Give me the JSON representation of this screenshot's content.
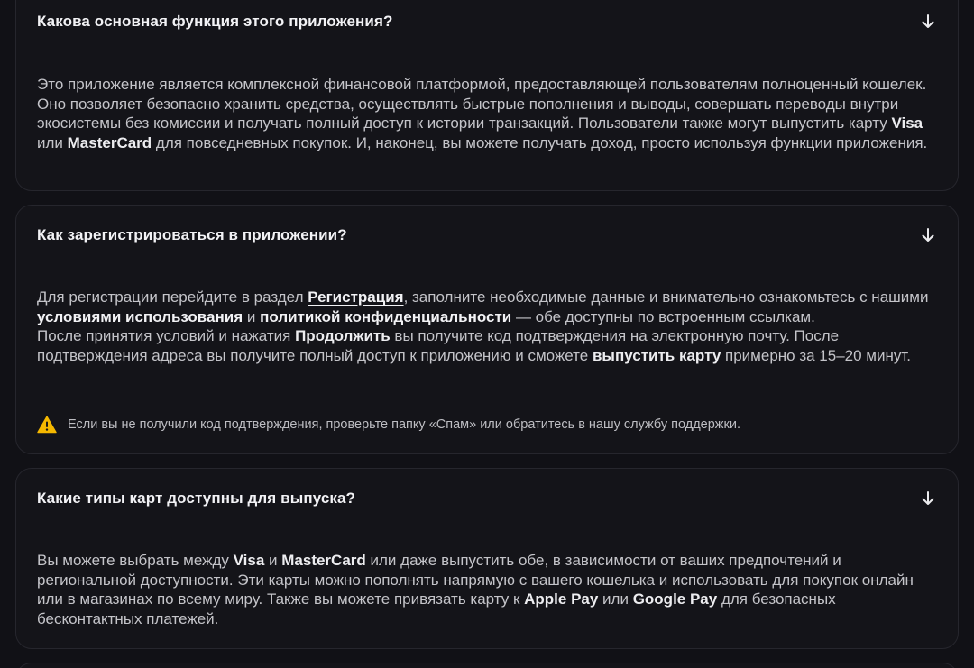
{
  "colors": {
    "background": "#111116",
    "card": "#141419",
    "border": "#26262d",
    "warning": "#f5b800"
  },
  "faq": [
    {
      "question": "Какова основная функция этого приложения?",
      "icon": "arrow-down-icon",
      "answer": {
        "t1": "Это приложение является комплексной финансовой платформой, предоставляющей пользователям полноценный кошелек. Оно позволяет безопасно хранить средства, осуществлять быстрые пополнения и выводы, совершать переводы внутри экосистемы без комиссии и получать полный доступ к истории транзакций. Пользователи также могут выпустить карту ",
        "b1": "Visa",
        "t2": " или ",
        "b2": "MasterCard",
        "t3": " для повседневных покупок. И, наконец, вы можете получать доход, просто используя функции приложения."
      }
    },
    {
      "question": "Как зарегистрироваться в приложении?",
      "icon": "arrow-down-icon",
      "answer": {
        "t1": "Для регистрации перейдите в раздел ",
        "link1": "Регистрация",
        "t2": ", заполните необходимые данные и внимательно ознакомьтесь с нашими ",
        "link2": "условиями использования",
        "t3": " и ",
        "link3": "политикой конфиденциальности",
        "t4": " — обе доступны по встроенным ссылкам.",
        "t5": "После принятия условий и нажатия ",
        "b1": "Продолжить",
        "t6": " вы получите код подтверждения на электронную почту. После подтверждения адреса вы получите полный доступ к приложению и сможете ",
        "b2": "выпустить карту",
        "t7": " примерно за 15–20 минут."
      },
      "warning": {
        "icon": "warning-icon",
        "text": "Если вы не получили код подтверждения, проверьте папку «Спам» или обратитесь в нашу службу поддержки."
      }
    },
    {
      "question": "Какие типы карт доступны для выпуска?",
      "icon": "arrow-down-icon",
      "answer": {
        "t1": "Вы можете выбрать между ",
        "b1": "Visa",
        "t2": " и ",
        "b2": "MasterCard",
        "t3": " или даже выпустить обе, в зависимости от ваших предпочтений и региональной доступности. Эти карты можно пополнять напрямую с вашего кошелька и использовать для покупок онлайн или в магазинах по всему миру. Также вы можете привязать карту к ",
        "b3": "Apple Pay",
        "t4": " или ",
        "b4": "Google Pay",
        "t5": " для безопасных бесконтактных платежей."
      }
    }
  ]
}
